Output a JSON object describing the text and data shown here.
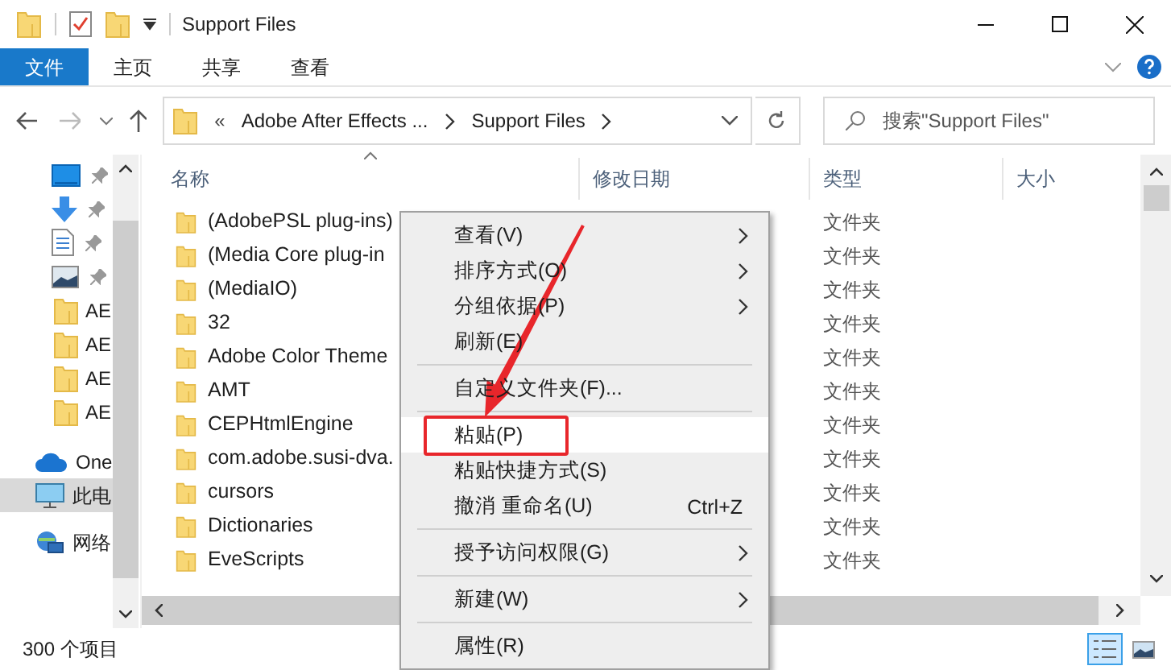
{
  "window": {
    "title": "Support Files"
  },
  "ribbon_tabs": [
    {
      "label": "文件",
      "selected": true
    },
    {
      "label": "主页",
      "selected": false
    },
    {
      "label": "共享",
      "selected": false
    },
    {
      "label": "查看",
      "selected": false
    }
  ],
  "address_bar": {
    "overflow": "«",
    "path": [
      "Adobe After Effects ...",
      "Support Files"
    ]
  },
  "search": {
    "placeholder": "搜索\"Support Files\""
  },
  "sidebar": {
    "items": [
      {
        "kind": "desktop",
        "pinned": true,
        "selected": false
      },
      {
        "kind": "downloads",
        "pinned": true,
        "selected": false
      },
      {
        "kind": "documents",
        "pinned": true,
        "selected": false
      },
      {
        "kind": "pictures",
        "pinned": true,
        "selected": false
      },
      {
        "kind": "folder",
        "label": "AE",
        "pinned": false,
        "selected": false
      },
      {
        "kind": "folder",
        "label": "AE",
        "pinned": false,
        "selected": false
      },
      {
        "kind": "folder",
        "label": "AE",
        "pinned": false,
        "selected": false
      },
      {
        "kind": "folder",
        "label": "AE",
        "pinned": false,
        "selected": false
      },
      {
        "kind": "cloud",
        "label": "One",
        "pinned": false,
        "selected": false
      },
      {
        "kind": "computer",
        "label": "此电",
        "pinned": false,
        "selected": true
      },
      {
        "kind": "network",
        "label": "网络",
        "pinned": false,
        "selected": false
      }
    ]
  },
  "columns": [
    {
      "label": "名称",
      "sorted": true
    },
    {
      "label": "修改日期",
      "sorted": false
    },
    {
      "label": "类型",
      "sorted": false
    },
    {
      "label": "大小",
      "sorted": false
    }
  ],
  "rows": [
    {
      "name": "(AdobePSL plug-ins)",
      "type": "文件夹"
    },
    {
      "name": "(Media Core plug-in",
      "type": "文件夹"
    },
    {
      "name": "(MediaIO)",
      "type": "文件夹"
    },
    {
      "name": "32",
      "type": "文件夹"
    },
    {
      "name": "Adobe Color Theme",
      "type": "文件夹"
    },
    {
      "name": "AMT",
      "type": "文件夹"
    },
    {
      "name": "CEPHtmlEngine",
      "type": "文件夹"
    },
    {
      "name": "com.adobe.susi-dva.",
      "type": "文件夹"
    },
    {
      "name": "cursors",
      "type": "文件夹"
    },
    {
      "name": "Dictionaries",
      "type": "文件夹"
    },
    {
      "name": "EveScripts",
      "type": "文件夹"
    }
  ],
  "context_menu": {
    "items": [
      {
        "kind": "item",
        "label": "查看(V)",
        "submenu": true,
        "selected": false
      },
      {
        "kind": "item",
        "label": "排序方式(O)",
        "submenu": true,
        "selected": false
      },
      {
        "kind": "item",
        "label": "分组依据(P)",
        "submenu": true,
        "selected": false
      },
      {
        "kind": "item",
        "label": "刷新(E)",
        "submenu": false,
        "selected": false
      },
      {
        "kind": "separator"
      },
      {
        "kind": "item",
        "label": "自定义文件夹(F)...",
        "submenu": false,
        "selected": false
      },
      {
        "kind": "separator"
      },
      {
        "kind": "item",
        "label": "粘贴(P)",
        "submenu": false,
        "selected": true
      },
      {
        "kind": "item",
        "label": "粘贴快捷方式(S)",
        "submenu": false,
        "selected": false
      },
      {
        "kind": "item",
        "label": "撤消 重命名(U)",
        "shortcut": "Ctrl+Z",
        "submenu": false,
        "selected": false
      },
      {
        "kind": "separator"
      },
      {
        "kind": "item",
        "label": "授予访问权限(G)",
        "submenu": true,
        "selected": false
      },
      {
        "kind": "separator"
      },
      {
        "kind": "item",
        "label": "新建(W)",
        "submenu": true,
        "selected": false
      },
      {
        "kind": "separator"
      },
      {
        "kind": "item",
        "label": "属性(R)",
        "submenu": false,
        "selected": false
      }
    ]
  },
  "status_bar": {
    "count": "300 个项目",
    "views": [
      {
        "kind": "details",
        "selected": true
      },
      {
        "kind": "large-icons",
        "selected": false
      }
    ]
  }
}
